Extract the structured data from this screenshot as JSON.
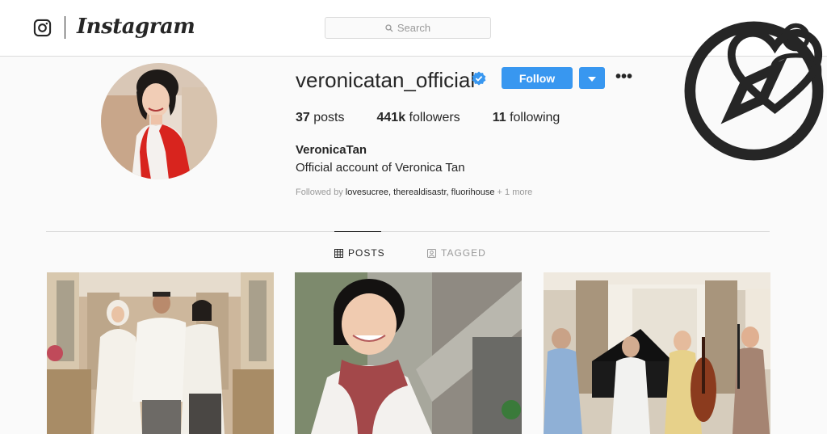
{
  "nav": {
    "wordmark": "Instagram",
    "search_placeholder": "Search",
    "icons": [
      "explore-compass-icon",
      "activity-heart-icon",
      "profile-person-icon"
    ]
  },
  "profile": {
    "username": "veronicatan_official",
    "verified": true,
    "follow_label": "Follow",
    "more_label": "•••",
    "stats": {
      "posts_count": "37",
      "posts_label": "posts",
      "followers_count": "441k",
      "followers_label": "followers",
      "following_count": "11",
      "following_label": "following"
    },
    "full_name": "VeronicaTan",
    "bio": "Official account of Veronica Tan",
    "followed_by": {
      "prefix": "Followed by",
      "names": [
        "lovesucree",
        "therealdisastr",
        "fluorihouse"
      ],
      "suffix": "+ 1 more"
    }
  },
  "tabs": {
    "posts_label": "POSTS",
    "tagged_label": "TAGGED",
    "active": "POSTS"
  },
  "colors": {
    "accent": "#3897f0",
    "verified": "#3897f0",
    "border": "#dbdbdb",
    "muted": "#999999"
  }
}
